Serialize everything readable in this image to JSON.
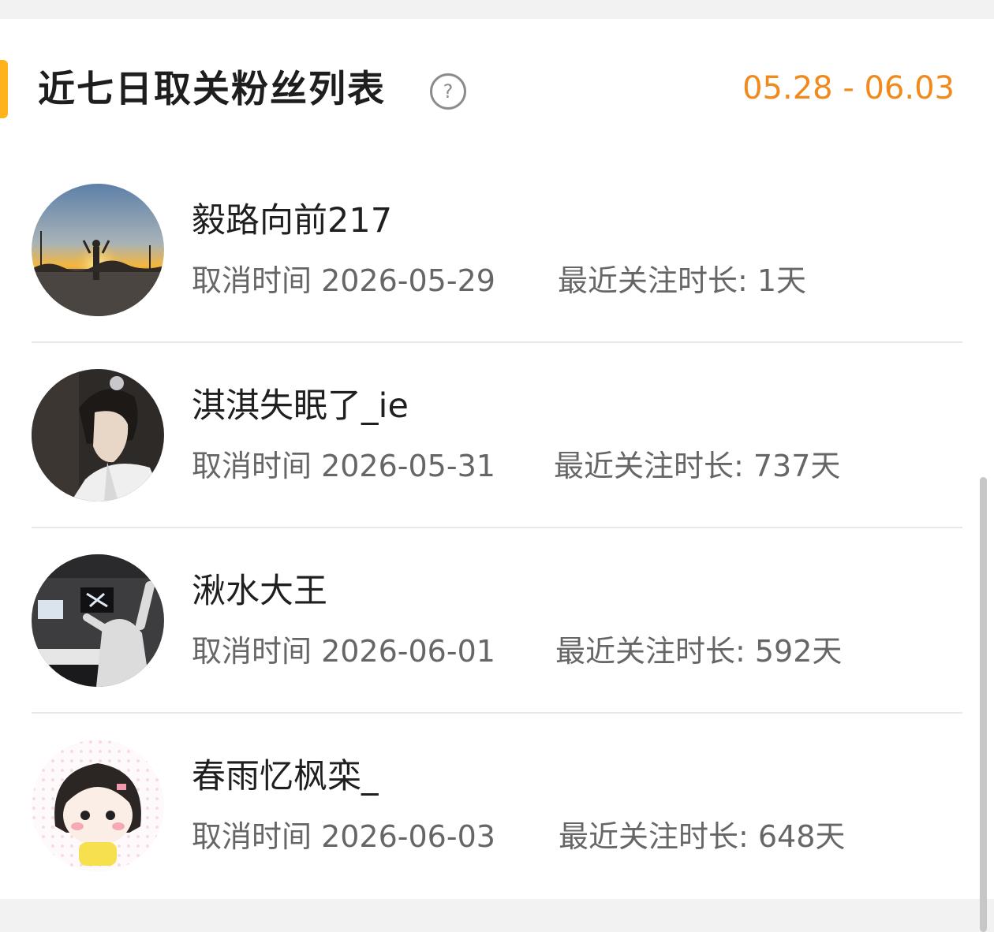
{
  "header": {
    "title": "近七日取关粉丝列表",
    "help_icon": "question-circle-icon",
    "date_range": "05.28 - 06.03"
  },
  "colors": {
    "accent": "#ffb31a",
    "date_range": "#f08a1c",
    "primary_text": "#1f1f1f",
    "secondary_text": "#666666"
  },
  "fans": [
    {
      "username": "毅路向前217",
      "cancel_time": "取消时间 2026-05-29",
      "follow_duration": "最近关注时长: 1天",
      "avatar_icon": "sunset-avatar"
    },
    {
      "username": "淇淇失眠了_ie",
      "cancel_time": "取消时间 2026-05-31",
      "follow_duration": "最近关注时长: 737天",
      "avatar_icon": "portrait-avatar"
    },
    {
      "username": "湫水大王",
      "cancel_time": "取消时间 2026-06-01",
      "follow_duration": "最近关注时长: 592天",
      "avatar_icon": "studio-avatar"
    },
    {
      "username": "春雨忆枫栾_",
      "cancel_time": "取消时间 2026-06-03",
      "follow_duration": "最近关注时长: 648天",
      "avatar_icon": "cartoon-girl-avatar"
    }
  ]
}
